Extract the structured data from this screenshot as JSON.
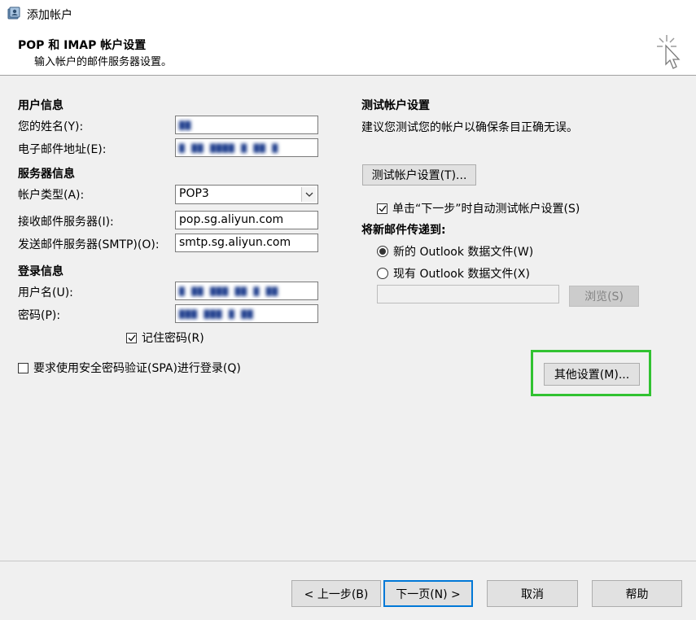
{
  "window": {
    "title": "添加帐户",
    "icon": "account-settings-icon"
  },
  "header": {
    "title": "POP 和 IMAP 帐户设置",
    "subtitle": "输入帐户的邮件服务器设置。",
    "icon": "cursor-click-icon"
  },
  "user_info": {
    "section_title": "用户信息",
    "name_label": "您的姓名(Y):",
    "name_value": "▇▇",
    "email_label": "电子邮件地址(E):",
    "email_value": "▇ ▇▇ ▇▇▇▇ ▇ ▇▇ ▇"
  },
  "server_info": {
    "section_title": "服务器信息",
    "account_type_label": "帐户类型(A):",
    "account_type_value": "POP3",
    "incoming_label": "接收邮件服务器(I):",
    "incoming_value": "pop.sg.aliyun.com",
    "outgoing_label": "发送邮件服务器(SMTP)(O):",
    "outgoing_value": "smtp.sg.aliyun.com"
  },
  "login_info": {
    "section_title": "登录信息",
    "username_label": "用户名(U):",
    "username_value": "▇ ▇▇ ▇▇▇ ▇▇ ▇ ▇▇",
    "password_label": "密码(P):",
    "password_value": "▇▇▇ ▇▇▇ ▇ ▇▇",
    "remember_label": "记住密码(R)",
    "remember_checked": true
  },
  "spa": {
    "label": "要求使用安全密码验证(SPA)进行登录(Q)",
    "checked": false
  },
  "test": {
    "section_title": "测试帐户设置",
    "description": "建议您测试您的帐户以确保条目正确无误。",
    "button_label": "测试帐户设置(T)...",
    "auto_test_label": "单击“下一步”时自动测试帐户设置(S)",
    "auto_test_checked": true
  },
  "deliver": {
    "section_title": "将新邮件传递到:",
    "option_new": "新的 Outlook 数据文件(W)",
    "option_existing": "现有 Outlook 数据文件(X)",
    "selected": "new",
    "browse_label": "浏览(S)"
  },
  "more_settings_label": "其他设置(M)...",
  "footer": {
    "back_label": "< 上一步(B)",
    "next_label": "下一页(N) >",
    "cancel_label": "取消",
    "help_label": "帮助"
  },
  "colors": {
    "highlight_box": "#31c231",
    "primary_border": "#0078d7"
  }
}
